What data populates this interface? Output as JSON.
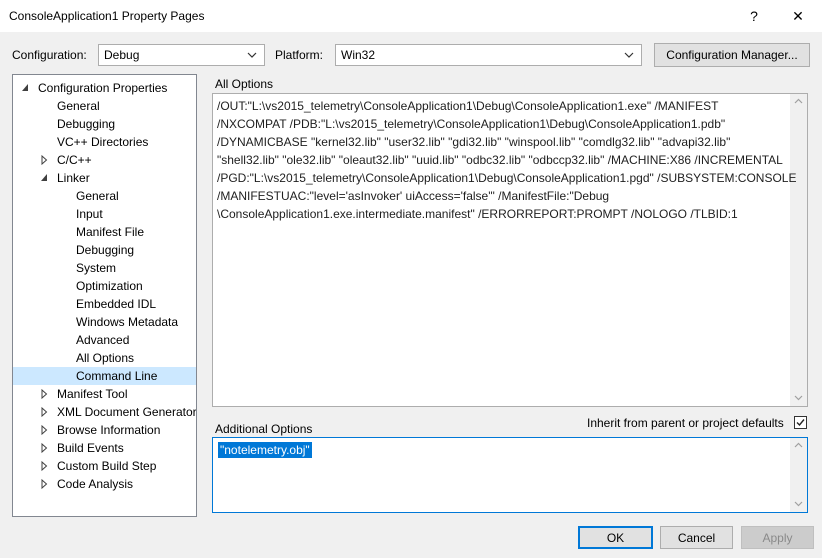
{
  "window": {
    "title": "ConsoleApplication1 Property Pages",
    "help_glyph": "?",
    "close_glyph": "✕"
  },
  "config_bar": {
    "configuration_label": "Configuration:",
    "configuration_value": "Debug",
    "platform_label": "Platform:",
    "platform_value": "Win32",
    "config_manager_label": "Configuration Manager..."
  },
  "tree": {
    "items": [
      {
        "label": "Configuration Properties",
        "expander": "expanded"
      },
      {
        "label": "General",
        "expander": "none"
      },
      {
        "label": "Debugging",
        "expander": "none"
      },
      {
        "label": "VC++ Directories",
        "expander": "none"
      },
      {
        "label": "C/C++",
        "expander": "collapsed"
      },
      {
        "label": "Linker",
        "expander": "expanded"
      },
      {
        "label": "General",
        "expander": "none"
      },
      {
        "label": "Input",
        "expander": "none"
      },
      {
        "label": "Manifest File",
        "expander": "none"
      },
      {
        "label": "Debugging",
        "expander": "none"
      },
      {
        "label": "System",
        "expander": "none"
      },
      {
        "label": "Optimization",
        "expander": "none"
      },
      {
        "label": "Embedded IDL",
        "expander": "none"
      },
      {
        "label": "Windows Metadata",
        "expander": "none"
      },
      {
        "label": "Advanced",
        "expander": "none"
      },
      {
        "label": "All Options",
        "expander": "none"
      },
      {
        "label": "Command Line",
        "expander": "none",
        "selected": true
      },
      {
        "label": "Manifest Tool",
        "expander": "collapsed"
      },
      {
        "label": "XML Document Generator",
        "expander": "collapsed"
      },
      {
        "label": "Browse Information",
        "expander": "collapsed"
      },
      {
        "label": "Build Events",
        "expander": "collapsed"
      },
      {
        "label": "Custom Build Step",
        "expander": "collapsed"
      },
      {
        "label": "Code Analysis",
        "expander": "collapsed"
      }
    ]
  },
  "all_options": {
    "heading": "All Options",
    "lines": [
      "/OUT:\"L:\\vs2015_telemetry\\ConsoleApplication1\\Debug\\ConsoleApplication1.exe\" /MANIFEST",
      "/NXCOMPAT /PDB:\"L:\\vs2015_telemetry\\ConsoleApplication1\\Debug\\ConsoleApplication1.pdb\"",
      "/DYNAMICBASE \"kernel32.lib\" \"user32.lib\" \"gdi32.lib\" \"winspool.lib\" \"comdlg32.lib\" \"advapi32.lib\"",
      "\"shell32.lib\" \"ole32.lib\" \"oleaut32.lib\" \"uuid.lib\" \"odbc32.lib\" \"odbccp32.lib\" /MACHINE:X86 /INCREMENTAL",
      "/PGD:\"L:\\vs2015_telemetry\\ConsoleApplication1\\Debug\\ConsoleApplication1.pgd\" /SUBSYSTEM:CONSOLE",
      "/MANIFESTUAC:\"level='asInvoker' uiAccess='false'\" /ManifestFile:\"Debug",
      "\\ConsoleApplication1.exe.intermediate.manifest\" /ERRORREPORT:PROMPT /NOLOGO /TLBID:1"
    ]
  },
  "additional_options": {
    "heading": "Additional Options",
    "value": "\"notelemetry.obj\"",
    "inherit_label": "Inherit from parent or project defaults",
    "inherit_checked": true
  },
  "footer": {
    "ok_label": "OK",
    "cancel_label": "Cancel",
    "apply_label": "Apply"
  }
}
